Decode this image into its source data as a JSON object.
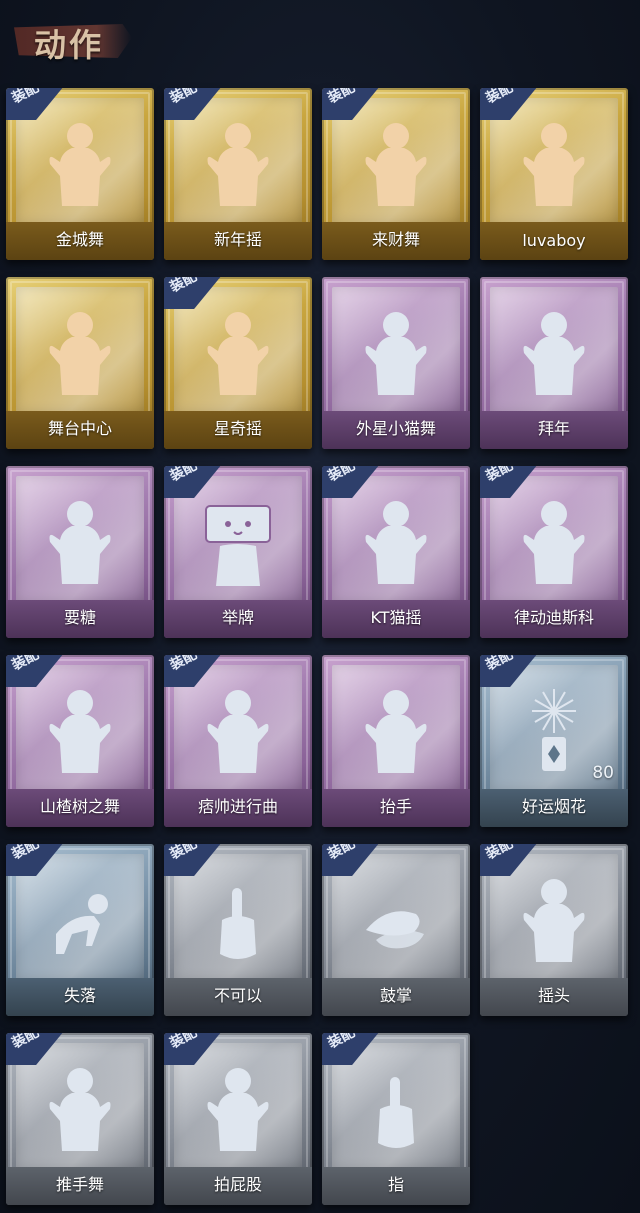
{
  "header": {
    "title": "动作"
  },
  "badge_label": "装配",
  "cards": [
    {
      "label": "金城舞",
      "tier": "gold",
      "equipped": true,
      "icon": "dance-pose-icon"
    },
    {
      "label": "新年摇",
      "tier": "gold",
      "equipped": true,
      "icon": "dance-pose-icon"
    },
    {
      "label": "来财舞",
      "tier": "gold",
      "equipped": true,
      "icon": "dance-pose-icon"
    },
    {
      "label": "luvaboy",
      "tier": "gold",
      "equipped": true,
      "icon": "dance-pose-icon"
    },
    {
      "label": "舞台中心",
      "tier": "gold",
      "equipped": false,
      "icon": "dance-pose-icon"
    },
    {
      "label": "星奇摇",
      "tier": "gold",
      "equipped": true,
      "icon": "dance-pose-icon"
    },
    {
      "label": "外星小猫舞",
      "tier": "purple",
      "equipped": false,
      "icon": "dance-pose-icon"
    },
    {
      "label": "拜年",
      "tier": "purple",
      "equipped": false,
      "icon": "bow-pose-icon"
    },
    {
      "label": "要糖",
      "tier": "purple",
      "equipped": false,
      "icon": "reach-pose-icon"
    },
    {
      "label": "举牌",
      "tier": "purple",
      "equipped": true,
      "icon": "sign-pose-icon"
    },
    {
      "label": "KT猫摇",
      "tier": "purple",
      "equipped": true,
      "icon": "dance-pose-icon"
    },
    {
      "label": "律动迪斯科",
      "tier": "purple",
      "equipped": true,
      "icon": "dance-pose-icon"
    },
    {
      "label": "山楂树之舞",
      "tier": "purple",
      "equipped": true,
      "icon": "dance-pose-icon"
    },
    {
      "label": "痞帅进行曲",
      "tier": "purple",
      "equipped": true,
      "icon": "dance-pose-icon"
    },
    {
      "label": "抬手",
      "tier": "purple",
      "equipped": false,
      "icon": "wave-pose-icon"
    },
    {
      "label": "好运烟花",
      "tier": "blue",
      "equipped": true,
      "icon": "firework-icon",
      "count": "80"
    },
    {
      "label": "失落",
      "tier": "blue",
      "equipped": true,
      "icon": "crawl-pose-icon"
    },
    {
      "label": "不可以",
      "tier": "gray",
      "equipped": true,
      "icon": "finger-wag-icon"
    },
    {
      "label": "鼓掌",
      "tier": "gray",
      "equipped": true,
      "icon": "clap-icon"
    },
    {
      "label": "摇头",
      "tier": "gray",
      "equipped": true,
      "icon": "shake-head-icon"
    },
    {
      "label": "推手舞",
      "tier": "gray",
      "equipped": true,
      "icon": "push-pose-icon"
    },
    {
      "label": "拍屁股",
      "tier": "gray",
      "equipped": true,
      "icon": "slap-pose-icon"
    },
    {
      "label": "指",
      "tier": "gray",
      "equipped": true,
      "icon": "point-hand-icon"
    }
  ],
  "colors": {
    "gold": "#c9a63f",
    "purple": "#a57fb2",
    "blue": "#7f98ae",
    "gray": "#8f959f",
    "badge": "#2e3f6b",
    "figure_gold": "#f2d2a8",
    "figure_other": "#dfe6ef"
  }
}
